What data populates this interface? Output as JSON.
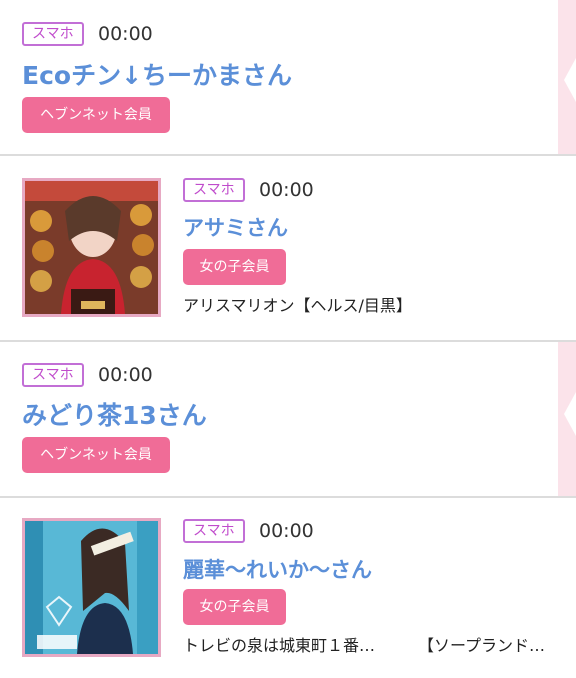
{
  "posts": [
    {
      "device": "スマホ",
      "time": "00:00",
      "name": "Ecoチン↓ちーかまさん",
      "member_type": "ヘブンネット会員"
    },
    {
      "device": "スマホ",
      "time": "00:00",
      "name": "アサミさん",
      "member_type": "女の子会員",
      "shop": "アリスマリオン【ヘルス/目黒】"
    },
    {
      "device": "スマホ",
      "time": "00:00",
      "name": "みどり茶13さん",
      "member_type": "ヘブンネット会員"
    },
    {
      "device": "スマホ",
      "time": "00:00",
      "name": "麗華〜れいか〜さん",
      "member_type": "女の子会員",
      "shop_area": "トレビの泉は城東町１番…",
      "shop_genre": "【ソープランド…"
    }
  ],
  "colors": {
    "accent_pink": "#f06c97",
    "name_blue": "#5b8fd8",
    "tag_purple": "#c26fd6"
  }
}
